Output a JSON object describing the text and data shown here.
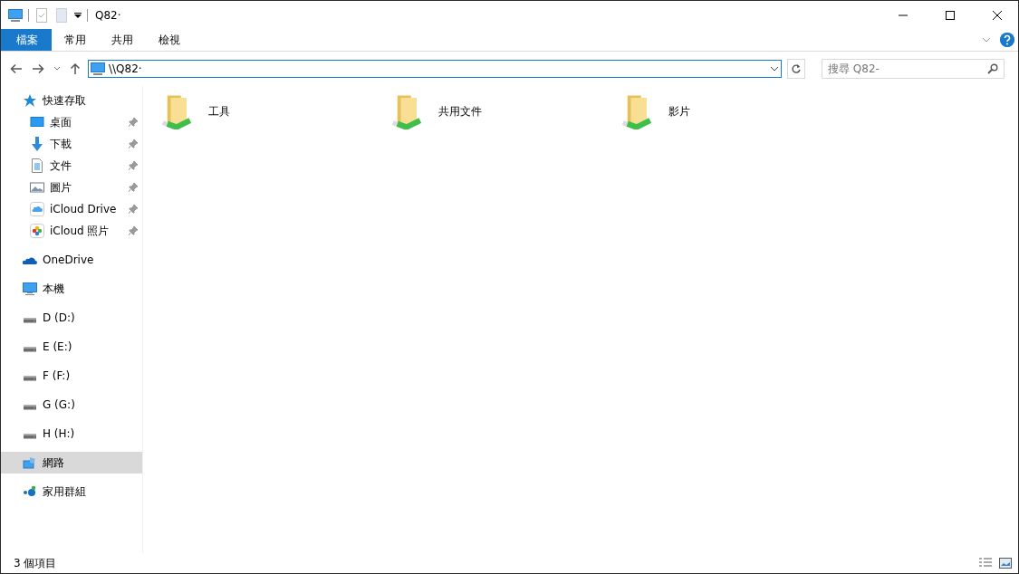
{
  "window": {
    "title": "Q82·"
  },
  "ribbon_tabs": [
    {
      "label": "檔案",
      "selected": true
    },
    {
      "label": "常用",
      "selected": false
    },
    {
      "label": "共用",
      "selected": false
    },
    {
      "label": "檢視",
      "selected": false
    }
  ],
  "address": {
    "value": "\\\\Q82·"
  },
  "search": {
    "placeholder": "搜尋 Q82-"
  },
  "sidebar": {
    "items": [
      {
        "label": "快速存取",
        "kind": "star",
        "selected": false,
        "children": [
          {
            "label": "桌面",
            "kind": "desktop",
            "selected": false
          },
          {
            "label": "下載",
            "kind": "download",
            "selected": false
          },
          {
            "label": "文件",
            "kind": "document",
            "selected": false
          },
          {
            "label": "圖片",
            "kind": "picture",
            "selected": false
          },
          {
            "label": "iCloud Drive",
            "kind": "icloud",
            "selected": false
          },
          {
            "label": "iCloud 照片",
            "kind": "photos",
            "selected": false
          }
        ]
      },
      {
        "label": "OneDrive",
        "kind": "onedrive",
        "selected": false
      },
      {
        "label": "本機",
        "kind": "pc",
        "selected": false
      },
      {
        "label": "D (D:)",
        "kind": "drive",
        "selected": false
      },
      {
        "label": "E (E:)",
        "kind": "drive",
        "selected": false
      },
      {
        "label": "F (F:)",
        "kind": "drive",
        "selected": false
      },
      {
        "label": "G (G:)",
        "kind": "drive",
        "selected": false
      },
      {
        "label": "H (H:)",
        "kind": "drive",
        "selected": false
      },
      {
        "label": "網路",
        "kind": "network",
        "selected": true
      },
      {
        "label": "家用群組",
        "kind": "homegroup",
        "selected": false
      }
    ]
  },
  "folders": [
    {
      "name": "工具"
    },
    {
      "name": "共用文件"
    },
    {
      "name": "影片"
    }
  ],
  "status_bar": {
    "count": "3 個項目"
  }
}
